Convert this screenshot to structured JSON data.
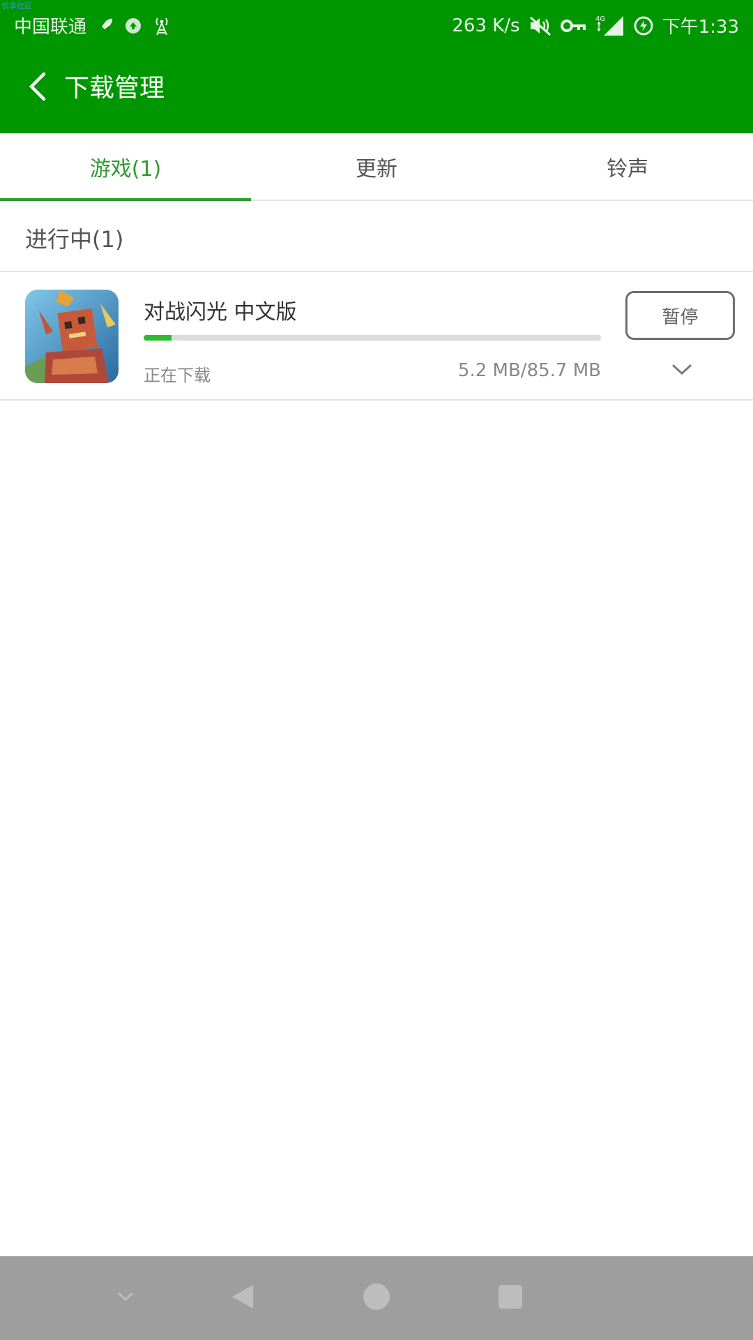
{
  "watermark": "悦享社区",
  "status_bar": {
    "carrier": "中国联通",
    "net_speed": "263 K/s",
    "network_type": "4G",
    "time": "下午1:33",
    "icons": [
      "rocket-icon",
      "app-notification-icon",
      "broadcast-icon",
      "mute-icon",
      "vpn-key-icon",
      "signal-icon",
      "battery-charging-icon"
    ]
  },
  "header": {
    "title": "下载管理",
    "back_icon": "back-arrow-icon",
    "color": "#009600"
  },
  "tabs": [
    {
      "label": "游戏(1)",
      "active": true
    },
    {
      "label": "更新",
      "active": false
    },
    {
      "label": "铃声",
      "active": false
    }
  ],
  "section": {
    "title": "进行中(1)"
  },
  "downloads": [
    {
      "name": "对战闪光  中文版",
      "status": "正在下载",
      "size": "5.2 MB/85.7 MB",
      "progress": 0.061,
      "pause_label": "暂停",
      "icon": "game-icon",
      "expand_icon": "chevron-down-icon"
    }
  ],
  "nav_bar": {
    "buttons": [
      "hide-nav-icon",
      "back-triangle-icon",
      "home-circle-icon",
      "recents-square-icon"
    ],
    "color": "#9e9e9e"
  },
  "colors": {
    "accent": "#2e9b2e",
    "progress": "#2fba2f"
  }
}
